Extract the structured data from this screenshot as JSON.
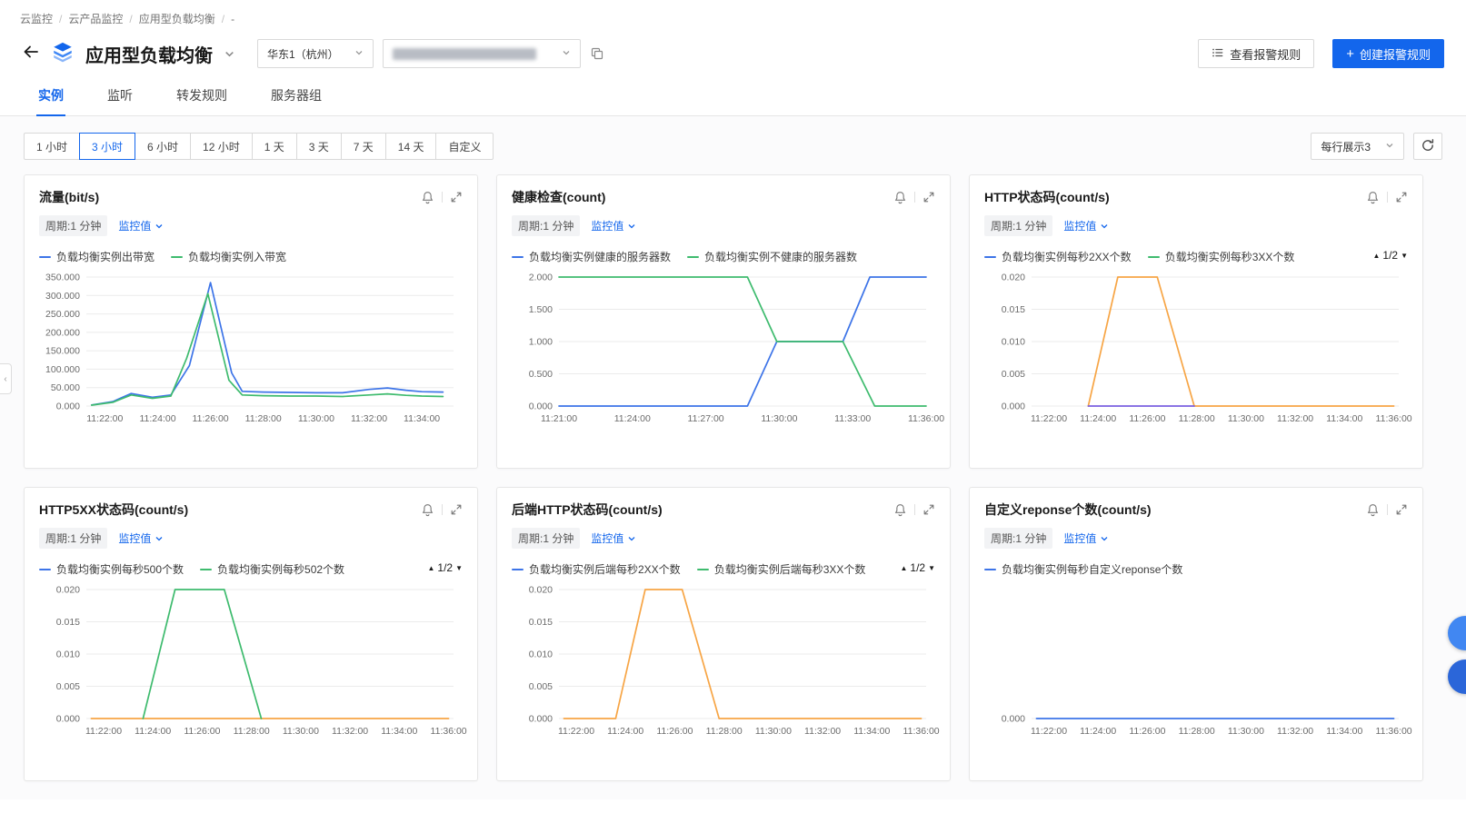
{
  "breadcrumb": {
    "items": [
      "云监控",
      "云产品监控",
      "应用型负载均衡",
      "-"
    ]
  },
  "header": {
    "title": "应用型负载均衡",
    "region": "华东1（杭州）",
    "view_rules_label": "查看报警规则",
    "create_rule_label": "创建报警规则",
    "create_rule_plus": "+"
  },
  "tabs": {
    "items": [
      {
        "label": "实例",
        "active": true
      },
      {
        "label": "监听",
        "active": false
      },
      {
        "label": "转发规则",
        "active": false
      },
      {
        "label": "服务器组",
        "active": false
      }
    ]
  },
  "time_range": {
    "options": [
      "1 小时",
      "3 小时",
      "6 小时",
      "12 小时",
      "1 天",
      "3 天",
      "7 天",
      "14 天",
      "自定义"
    ],
    "active": "3 小时"
  },
  "toolbar": {
    "per_row_label": "每行展示3"
  },
  "shared": {
    "period_label": "周期:1 分钟",
    "metric_link": "监控值"
  },
  "icons": {
    "pager_up": "▲",
    "pager_down": "▼",
    "collapse_left": "‹"
  },
  "colors": {
    "primary": "#1366ec",
    "line_blue": "#3D74E8",
    "line_green": "#3EBB6E",
    "line_orange": "#F7A545",
    "line_purple": "#7B61E0"
  },
  "charts": [
    {
      "title": "流量(bit/s)",
      "pager": null,
      "legend": [
        {
          "label": "负载均衡实例出带宽",
          "color": "#3D74E8"
        },
        {
          "label": "负载均衡实例入带宽",
          "color": "#3EBB6E"
        }
      ],
      "chart_data": {
        "type": "line",
        "x_domain": [
          21.3,
          35.2
        ],
        "x_ticks": [
          {
            "v": 22,
            "label": "11:22:00"
          },
          {
            "v": 24,
            "label": "11:24:00"
          },
          {
            "v": 26,
            "label": "11:26:00"
          },
          {
            "v": 28,
            "label": "11:28:00"
          },
          {
            "v": 30,
            "label": "11:30:00"
          },
          {
            "v": 32,
            "label": "11:32:00"
          },
          {
            "v": 34,
            "label": "11:34:00"
          }
        ],
        "y_max": 350000,
        "y_ticks": [
          {
            "v": 0,
            "label": "0.000"
          },
          {
            "v": 50000,
            "label": "50.000"
          },
          {
            "v": 100000,
            "label": "100.000"
          },
          {
            "v": 150000,
            "label": "150.000"
          },
          {
            "v": 200000,
            "label": "200.000"
          },
          {
            "v": 250000,
            "label": "250.000"
          },
          {
            "v": 300000,
            "label": "300.000"
          },
          {
            "v": 350000,
            "label": "350.000"
          }
        ],
        "series": [
          {
            "name": "负载均衡实例出带宽",
            "color": "#3D74E8",
            "points": [
              [
                21.5,
                3000
              ],
              [
                22.3,
                12000
              ],
              [
                23,
                34000
              ],
              [
                23.8,
                24000
              ],
              [
                24.5,
                30000
              ],
              [
                25.2,
                110000
              ],
              [
                26,
                335000
              ],
              [
                26.8,
                90000
              ],
              [
                27.2,
                40000
              ],
              [
                28,
                38000
              ],
              [
                29,
                37000
              ],
              [
                30,
                36000
              ],
              [
                31,
                36000
              ],
              [
                32,
                45000
              ],
              [
                32.7,
                49000
              ],
              [
                33.4,
                43000
              ],
              [
                34,
                39000
              ],
              [
                34.8,
                38000
              ]
            ]
          },
          {
            "name": "负载均衡实例入带宽",
            "color": "#3EBB6E",
            "points": [
              [
                21.5,
                2500
              ],
              [
                22.3,
                10000
              ],
              [
                23,
                30000
              ],
              [
                23.8,
                21000
              ],
              [
                24.5,
                27000
              ],
              [
                25.1,
                130000
              ],
              [
                25.9,
                305000
              ],
              [
                26.7,
                70000
              ],
              [
                27.2,
                30000
              ],
              [
                28,
                28000
              ],
              [
                29,
                27000
              ],
              [
                30,
                27000
              ],
              [
                31,
                26000
              ],
              [
                32,
                30000
              ],
              [
                32.7,
                33000
              ],
              [
                33.4,
                29000
              ],
              [
                34,
                27000
              ],
              [
                34.8,
                26000
              ]
            ]
          }
        ]
      }
    },
    {
      "title": "健康检查(count)",
      "pager": null,
      "legend": [
        {
          "label": "负载均衡实例健康的服务器数",
          "color": "#3D74E8"
        },
        {
          "label": "负载均衡实例不健康的服务器数",
          "color": "#3EBB6E"
        }
      ],
      "chart_data": {
        "type": "line",
        "x_domain": [
          21,
          36
        ],
        "x_ticks": [
          {
            "v": 21,
            "label": "11:21:00"
          },
          {
            "v": 24,
            "label": "11:24:00"
          },
          {
            "v": 27,
            "label": "11:27:00"
          },
          {
            "v": 30,
            "label": "11:30:00"
          },
          {
            "v": 33,
            "label": "11:33:00"
          },
          {
            "v": 36,
            "label": "11:36:00"
          }
        ],
        "y_max": 2,
        "y_ticks": [
          {
            "v": 0,
            "label": "0.000"
          },
          {
            "v": 0.5,
            "label": "0.500"
          },
          {
            "v": 1,
            "label": "1.000"
          },
          {
            "v": 1.5,
            "label": "1.500"
          },
          {
            "v": 2,
            "label": "2.000"
          }
        ],
        "series": [
          {
            "name": "负载均衡实例健康的服务器数",
            "color": "#3D74E8",
            "points": [
              [
                21,
                0
              ],
              [
                28.7,
                0
              ],
              [
                29.9,
                1
              ],
              [
                32.6,
                1
              ],
              [
                33.7,
                2
              ],
              [
                36,
                2
              ]
            ]
          },
          {
            "name": "负载均衡实例不健康的服务器数",
            "color": "#3EBB6E",
            "points": [
              [
                21,
                2
              ],
              [
                28.7,
                2
              ],
              [
                29.9,
                1
              ],
              [
                32.6,
                1
              ],
              [
                33.9,
                0
              ],
              [
                36,
                0
              ]
            ]
          }
        ]
      }
    },
    {
      "title": "HTTP状态码(count/s)",
      "pager": "1/2",
      "legend": [
        {
          "label": "负载均衡实例每秒2XX个数",
          "color": "#3D74E8"
        },
        {
          "label": "负载均衡实例每秒3XX个数",
          "color": "#3EBB6E"
        }
      ],
      "chart_data": {
        "type": "line",
        "x_domain": [
          21.3,
          36.2
        ],
        "x_ticks": [
          {
            "v": 22,
            "label": "11:22:00"
          },
          {
            "v": 24,
            "label": "11:24:00"
          },
          {
            "v": 26,
            "label": "11:26:00"
          },
          {
            "v": 28,
            "label": "11:28:00"
          },
          {
            "v": 30,
            "label": "11:30:00"
          },
          {
            "v": 32,
            "label": "11:32:00"
          },
          {
            "v": 34,
            "label": "11:34:00"
          },
          {
            "v": 36,
            "label": "11:36:00"
          }
        ],
        "y_max": 0.02,
        "y_ticks": [
          {
            "v": 0,
            "label": "0.000"
          },
          {
            "v": 0.005,
            "label": "0.005"
          },
          {
            "v": 0.01,
            "label": "0.010"
          },
          {
            "v": 0.015,
            "label": "0.015"
          },
          {
            "v": 0.02,
            "label": "0.020"
          }
        ],
        "series": [
          {
            "color": "#F7A545",
            "points": [
              [
                23.6,
                0
              ],
              [
                24.8,
                0.02
              ],
              [
                26.4,
                0.02
              ],
              [
                27.9,
                0
              ],
              [
                36,
                0
              ]
            ]
          },
          {
            "color": "#7B61E0",
            "points": [
              [
                23.6,
                0
              ],
              [
                27.9,
                0
              ]
            ]
          }
        ]
      }
    },
    {
      "title": "HTTP5XX状态码(count/s)",
      "pager": "1/2",
      "legend": [
        {
          "label": "负载均衡实例每秒500个数",
          "color": "#3D74E8"
        },
        {
          "label": "负载均衡实例每秒502个数",
          "color": "#3EBB6E"
        }
      ],
      "chart_data": {
        "type": "line",
        "x_domain": [
          21.3,
          36.2
        ],
        "x_ticks": [
          {
            "v": 22,
            "label": "11:22:00"
          },
          {
            "v": 24,
            "label": "11:24:00"
          },
          {
            "v": 26,
            "label": "11:26:00"
          },
          {
            "v": 28,
            "label": "11:28:00"
          },
          {
            "v": 30,
            "label": "11:30:00"
          },
          {
            "v": 32,
            "label": "11:32:00"
          },
          {
            "v": 34,
            "label": "11:34:00"
          },
          {
            "v": 36,
            "label": "11:36:00"
          }
        ],
        "y_max": 0.02,
        "y_ticks": [
          {
            "v": 0,
            "label": "0.000"
          },
          {
            "v": 0.005,
            "label": "0.005"
          },
          {
            "v": 0.01,
            "label": "0.010"
          },
          {
            "v": 0.015,
            "label": "0.015"
          },
          {
            "v": 0.02,
            "label": "0.020"
          }
        ],
        "series": [
          {
            "color": "#F7A545",
            "points": [
              [
                21.5,
                0
              ],
              [
                36,
                0
              ]
            ]
          },
          {
            "color": "#3EBB6E",
            "points": [
              [
                23.6,
                0
              ],
              [
                24.9,
                0.02
              ],
              [
                26.9,
                0.02
              ],
              [
                28.4,
                0
              ]
            ]
          }
        ]
      }
    },
    {
      "title": "后端HTTP状态码(count/s)",
      "pager": "1/2",
      "legend": [
        {
          "label": "负载均衡实例后端每秒2XX个数",
          "color": "#3D74E8"
        },
        {
          "label": "负载均衡实例后端每秒3XX个数",
          "color": "#3EBB6E"
        }
      ],
      "chart_data": {
        "type": "line",
        "x_domain": [
          21.3,
          36.2
        ],
        "x_ticks": [
          {
            "v": 22,
            "label": "11:22:00"
          },
          {
            "v": 24,
            "label": "11:24:00"
          },
          {
            "v": 26,
            "label": "11:26:00"
          },
          {
            "v": 28,
            "label": "11:28:00"
          },
          {
            "v": 30,
            "label": "11:30:00"
          },
          {
            "v": 32,
            "label": "11:32:00"
          },
          {
            "v": 34,
            "label": "11:34:00"
          },
          {
            "v": 36,
            "label": "11:36:00"
          }
        ],
        "y_max": 0.02,
        "y_ticks": [
          {
            "v": 0,
            "label": "0.000"
          },
          {
            "v": 0.005,
            "label": "0.005"
          },
          {
            "v": 0.01,
            "label": "0.010"
          },
          {
            "v": 0.015,
            "label": "0.015"
          },
          {
            "v": 0.02,
            "label": "0.020"
          }
        ],
        "series": [
          {
            "color": "#F7A545",
            "points": [
              [
                21.5,
                0
              ],
              [
                23.6,
                0
              ],
              [
                24.8,
                0.02
              ],
              [
                26.3,
                0.02
              ],
              [
                27.8,
                0
              ],
              [
                36,
                0
              ]
            ]
          }
        ]
      }
    },
    {
      "title": "自定义reponse个数(count/s)",
      "pager": null,
      "legend": [
        {
          "label": "负载均衡实例每秒自定义reponse个数",
          "color": "#3D74E8"
        }
      ],
      "chart_data": {
        "type": "line",
        "x_domain": [
          21.3,
          36.2
        ],
        "x_ticks": [
          {
            "v": 22,
            "label": "11:22:00"
          },
          {
            "v": 24,
            "label": "11:24:00"
          },
          {
            "v": 26,
            "label": "11:26:00"
          },
          {
            "v": 28,
            "label": "11:28:00"
          },
          {
            "v": 30,
            "label": "11:30:00"
          },
          {
            "v": 32,
            "label": "11:32:00"
          },
          {
            "v": 34,
            "label": "11:34:00"
          },
          {
            "v": 36,
            "label": "11:36:00"
          }
        ],
        "y_max": 0.02,
        "y_ticks": [
          {
            "v": 0,
            "label": "0.000"
          }
        ],
        "series": [
          {
            "name": "负载均衡实例每秒自定义reponse个数",
            "color": "#3D74E8",
            "points": [
              [
                21.5,
                0
              ],
              [
                36,
                0
              ]
            ]
          }
        ]
      }
    }
  ]
}
